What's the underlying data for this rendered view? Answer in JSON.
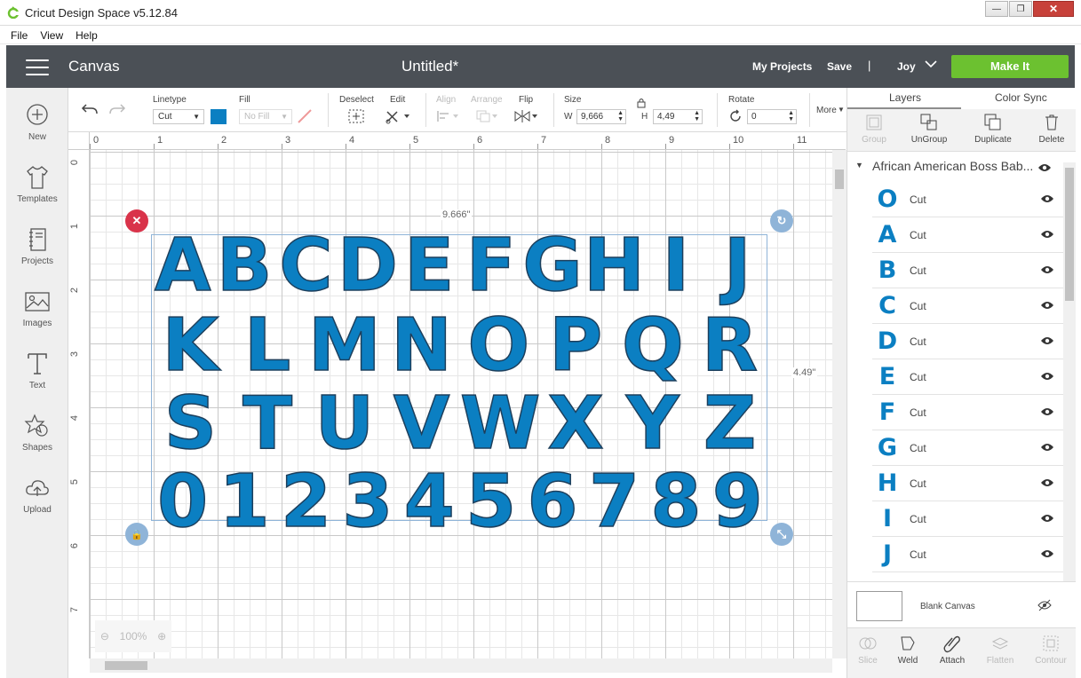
{
  "window": {
    "title": "Cricut Design Space  v5.12.84"
  },
  "menu": [
    "File",
    "View",
    "Help"
  ],
  "header": {
    "section": "Canvas",
    "doc_title": "Untitled*",
    "my_projects": "My Projects",
    "save": "Save",
    "separator": "|",
    "user": "Joy",
    "make_it": "Make It",
    "colors": {
      "bar": "#4b5056",
      "make_it": "#6cc130"
    }
  },
  "sidebar": [
    {
      "label": "New",
      "icon": "plus-circle-icon"
    },
    {
      "label": "Templates",
      "icon": "tshirt-icon"
    },
    {
      "label": "Projects",
      "icon": "notebook-icon"
    },
    {
      "label": "Images",
      "icon": "image-icon"
    },
    {
      "label": "Text",
      "icon": "text-icon"
    },
    {
      "label": "Shapes",
      "icon": "shapes-icon"
    },
    {
      "label": "Upload",
      "icon": "cloud-upload-icon"
    }
  ],
  "toolbar": {
    "linetype_label": "Linetype",
    "linetype_value": "Cut",
    "fill_label": "Fill",
    "fill_value": "No Fill",
    "deselect": "Deselect",
    "edit": "Edit",
    "align": "Align",
    "arrange": "Arrange",
    "flip": "Flip",
    "size": "Size",
    "w_label": "W",
    "w_value": "9,666",
    "h_label": "H",
    "h_value": "4,49",
    "rotate": "Rotate",
    "rotate_value": "0",
    "more": "More",
    "color": "#0b7fc2"
  },
  "ruler": {
    "h": [
      "0",
      "1",
      "2",
      "3",
      "4",
      "5",
      "6",
      "7",
      "8",
      "9",
      "10",
      "11"
    ],
    "v": [
      "0",
      "1",
      "2",
      "3",
      "4",
      "5",
      "6",
      "7"
    ]
  },
  "canvas": {
    "width_label": "9.666\"",
    "height_label": "4.49\"",
    "zoom": "100%",
    "rows": [
      [
        "A",
        "B",
        "C",
        "D",
        "E",
        "F",
        "G",
        "H",
        "I",
        "J"
      ],
      [
        "K",
        "L",
        "M",
        "N",
        "O",
        "P",
        "Q",
        "R"
      ],
      [
        "S",
        "T",
        "U",
        "V",
        "W",
        "X",
        "Y",
        "Z"
      ],
      [
        "0",
        "1",
        "2",
        "3",
        "4",
        "5",
        "6",
        "7",
        "8",
        "9"
      ]
    ]
  },
  "panel": {
    "tabs": [
      "Layers",
      "Color Sync"
    ],
    "actions": [
      "Group",
      "UnGroup",
      "Duplicate",
      "Delete"
    ],
    "group_name": "African American Boss Bab...",
    "layers": [
      {
        "glyph": "O",
        "op": "Cut"
      },
      {
        "glyph": "A",
        "op": "Cut"
      },
      {
        "glyph": "B",
        "op": "Cut"
      },
      {
        "glyph": "C",
        "op": "Cut"
      },
      {
        "glyph": "D",
        "op": "Cut"
      },
      {
        "glyph": "E",
        "op": "Cut"
      },
      {
        "glyph": "F",
        "op": "Cut"
      },
      {
        "glyph": "G",
        "op": "Cut"
      },
      {
        "glyph": "H",
        "op": "Cut"
      },
      {
        "glyph": "I",
        "op": "Cut"
      },
      {
        "glyph": "J",
        "op": "Cut"
      }
    ],
    "blank_canvas": "Blank Canvas",
    "bottom_actions": [
      "Slice",
      "Weld",
      "Attach",
      "Flatten",
      "Contour"
    ]
  }
}
